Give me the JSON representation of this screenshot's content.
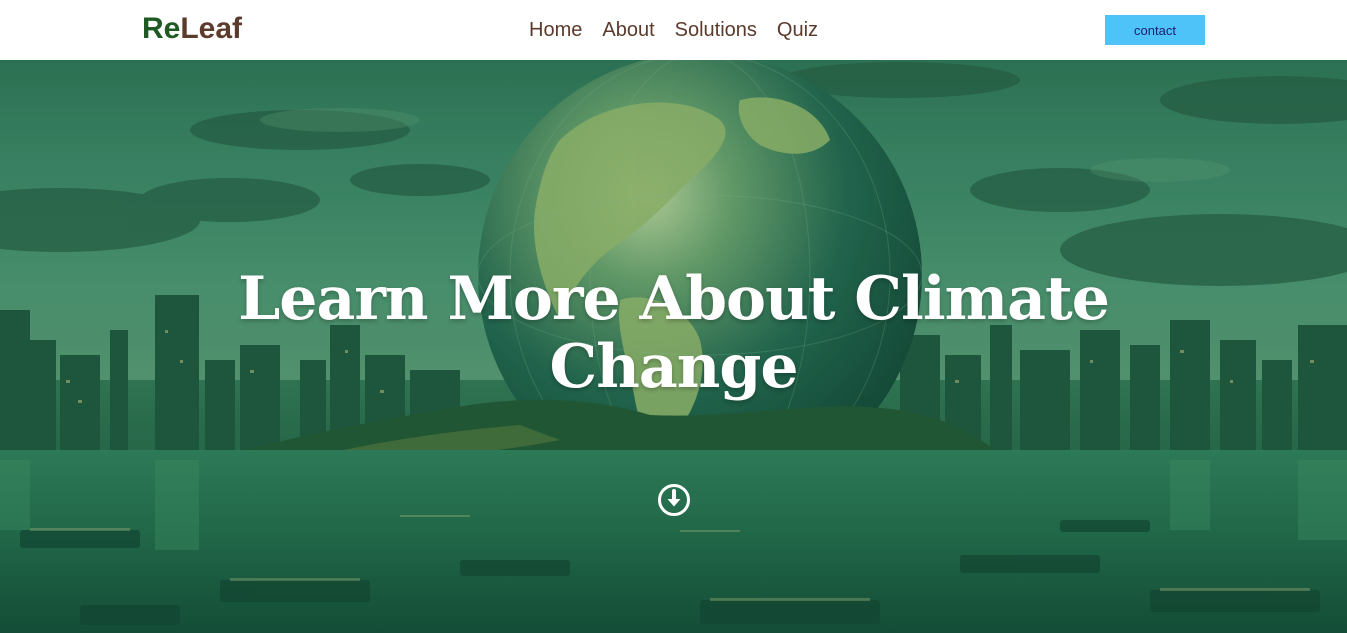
{
  "header": {
    "logo": {
      "part1": "Re",
      "part2": "Leaf"
    },
    "nav": [
      {
        "label": "Home"
      },
      {
        "label": "About"
      },
      {
        "label": "Solutions"
      },
      {
        "label": "Quiz"
      }
    ],
    "contact_label": "contact"
  },
  "hero": {
    "title": "Learn More About Climate Change",
    "scroll_icon": "arrow-down-circle-icon",
    "background": "green-tinted globe over flooded city skyline"
  },
  "colors": {
    "logo_re": "#1f5a23",
    "logo_leaf": "#5a3b2c",
    "nav_text": "#5b3a2c",
    "contact_bg": "#4ec3f7",
    "contact_text": "#1c1c6e",
    "hero_tint": "#2f7a57"
  }
}
